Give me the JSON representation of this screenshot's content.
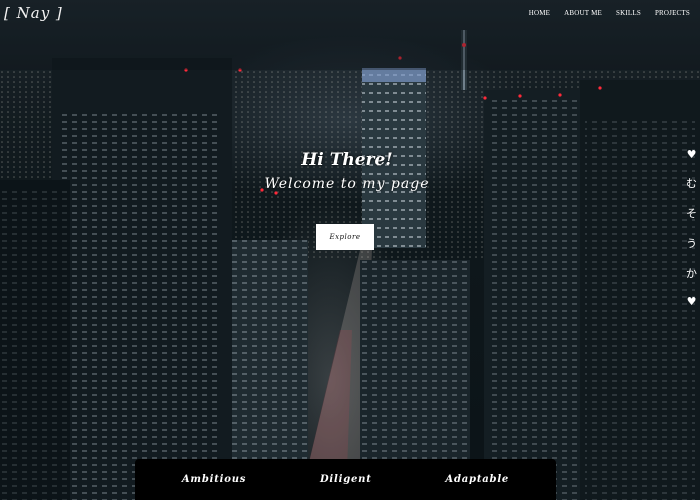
{
  "brand": {
    "logo": "[ Nay ]"
  },
  "nav": {
    "items": [
      {
        "label": "HOME"
      },
      {
        "label": "ABOUT ME"
      },
      {
        "label": "SKILLS"
      },
      {
        "label": "PROJECTS"
      }
    ]
  },
  "hero": {
    "title": "Hi There!",
    "subtitle": "Welcome to my page",
    "button_label": "Explore",
    "background_image": "night-city-skyline"
  },
  "side_rail": {
    "items": [
      "♥",
      "む",
      "そ",
      "う",
      "か",
      "♥"
    ]
  },
  "traits": {
    "items": [
      "Ambitious",
      "Diligent",
      "Adaptable"
    ]
  }
}
